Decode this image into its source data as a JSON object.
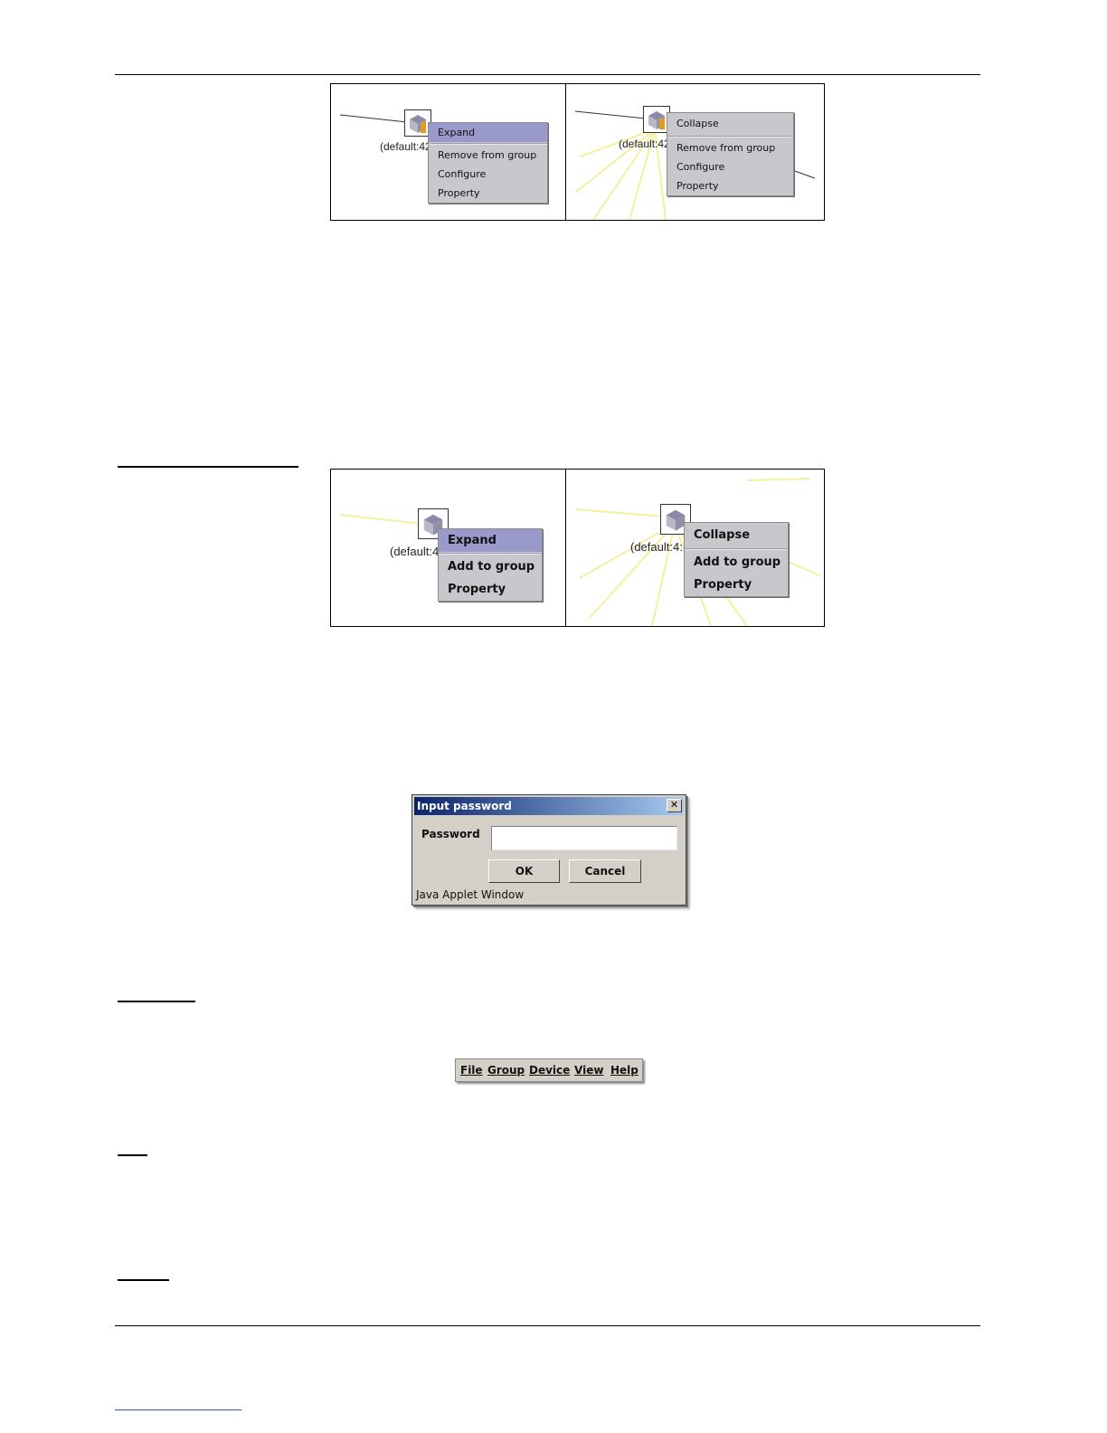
{
  "figure1": {
    "left": {
      "node_label": "(default:42",
      "menu": [
        "Expand",
        "Remove from group",
        "Configure",
        "Property"
      ]
    },
    "right": {
      "node_label": "(default:42",
      "menu": [
        "Collapse",
        "Remove from group",
        "Configure",
        "Property"
      ]
    }
  },
  "figure2": {
    "left": {
      "node_label": "(default:4",
      "menu": [
        "Expand",
        "Add to group",
        "Property"
      ]
    },
    "right": {
      "node_label": "(default:4:",
      "menu": [
        "Collapse",
        "Add to group",
        "Property"
      ]
    }
  },
  "dialog": {
    "title": "Input password",
    "close": "✕",
    "password_label": "Password",
    "password_value": "",
    "ok": "OK",
    "cancel": "Cancel",
    "status": "Java Applet Window"
  },
  "menubar": {
    "items": [
      "File",
      "Group",
      "Device",
      "View",
      "Help"
    ]
  }
}
